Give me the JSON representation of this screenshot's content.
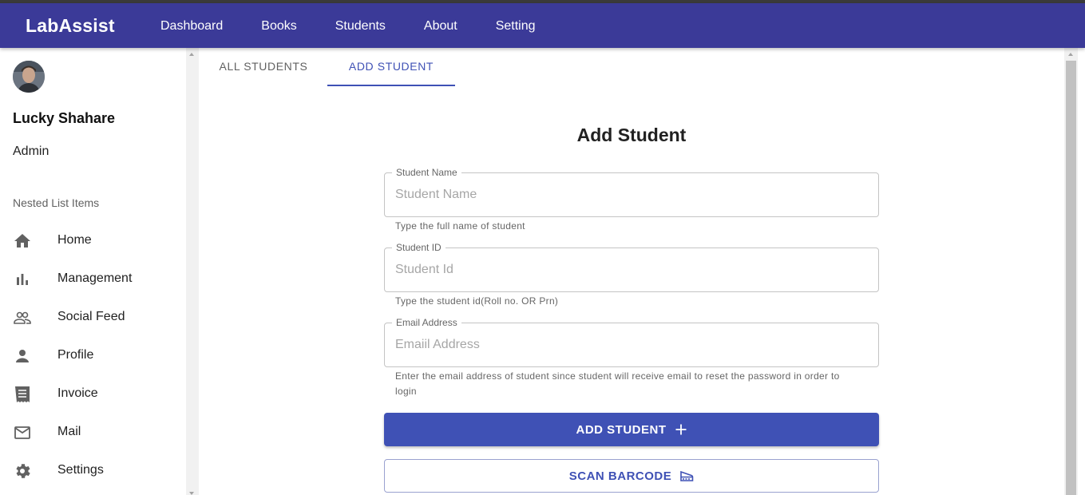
{
  "app": {
    "brand": "LabAssist"
  },
  "nav": [
    "Dashboard",
    "Books",
    "Students",
    "About",
    "Setting"
  ],
  "user": {
    "name": "Lucky Shahare",
    "role": "Admin"
  },
  "sidebar": {
    "subheader": "Nested List Items",
    "items": [
      {
        "label": "Home",
        "icon": "home-icon"
      },
      {
        "label": "Management",
        "icon": "bar-chart-icon"
      },
      {
        "label": "Social Feed",
        "icon": "people-icon"
      },
      {
        "label": "Profile",
        "icon": "person-icon"
      },
      {
        "label": "Invoice",
        "icon": "receipt-icon"
      },
      {
        "label": "Mail",
        "icon": "mail-icon"
      },
      {
        "label": "Settings",
        "icon": "gear-icon"
      }
    ]
  },
  "tabs": [
    {
      "label": "ALL STUDENTS",
      "active": false
    },
    {
      "label": "ADD STUDENT",
      "active": true
    }
  ],
  "form": {
    "title": "Add Student",
    "fields": [
      {
        "legend": "Student Name",
        "placeholder": "Student Name",
        "value": "",
        "helper": "Type the full name of student"
      },
      {
        "legend": "Student ID",
        "placeholder": "Student Id",
        "value": "",
        "helper": "Type the student id(Roll no. OR Prn)"
      },
      {
        "legend": "Email Address",
        "placeholder": "Emaiil Address",
        "value": "",
        "helper": "Enter the email address of student since student will receive email to reset the password in order to login"
      }
    ],
    "submit_label": "ADD STUDENT",
    "scan_label": "SCAN BARCODE"
  },
  "colors": {
    "appbar": "#3b3a98",
    "primary": "#3f51b5"
  }
}
